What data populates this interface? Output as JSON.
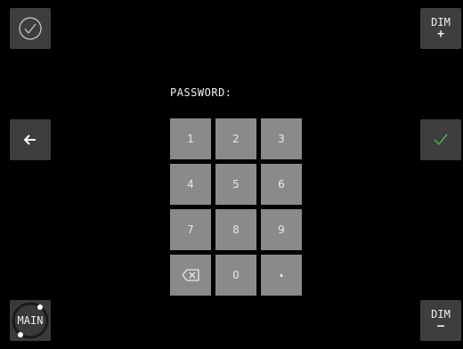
{
  "corners": {
    "top_left_icon": "check-circle-icon",
    "mid_left_icon": "arrow-left-icon",
    "mid_right_icon": "check-icon",
    "bottom_left_label": "MAIN",
    "dim_plus": {
      "label": "DIM",
      "sign": "+"
    },
    "dim_minus": {
      "label": "DIM",
      "sign": "–"
    }
  },
  "password_label": "PASSWORD:",
  "keypad": {
    "keys": [
      "1",
      "2",
      "3",
      "4",
      "5",
      "6",
      "7",
      "8",
      "9",
      "",
      "0",
      "·"
    ],
    "backspace_icon": "backspace-icon"
  },
  "colors": {
    "background": "#000000",
    "button": "#3e3e3e",
    "key": "#8a8a8a",
    "confirm_check": "#4cb84c"
  }
}
